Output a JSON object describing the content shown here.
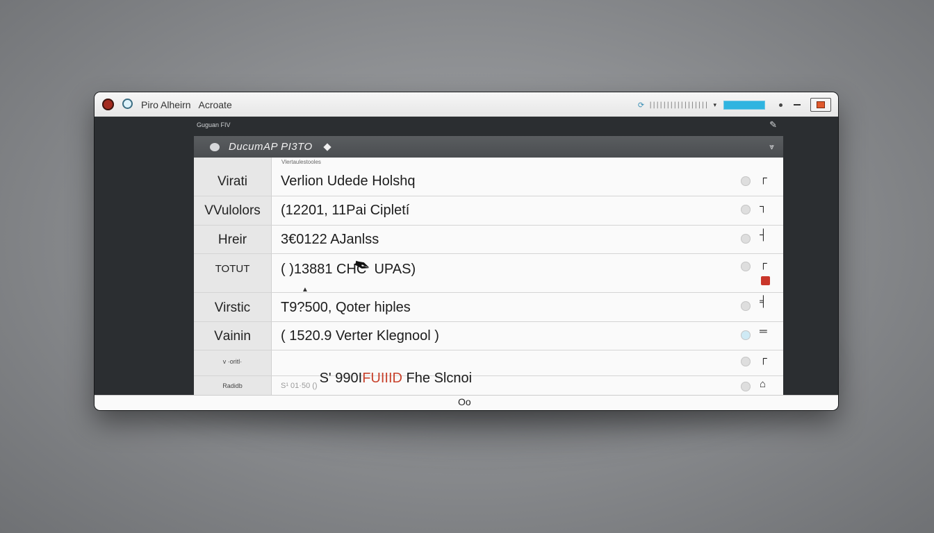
{
  "window": {
    "title": "Piro Alheirn   Acroate"
  },
  "titlebar": {
    "gauge_text": "|||||||||||||||||",
    "icons": [
      "refresh-icon",
      "progress-bar",
      "dot-icon",
      "minimize-icon",
      "maximize-icon"
    ]
  },
  "toolbar": {
    "breadcrumb": "Guguan FIV",
    "edit_icon": "pen-icon"
  },
  "panel": {
    "title": "DucumAP PI3TO",
    "subheader": "Vlertaulestooles",
    "collapse_icon": "chevron-down-icon"
  },
  "rows": [
    {
      "label": "Virati",
      "text": "Verlion Udede Holshq"
    },
    {
      "label": "VVulolors",
      "text": "(12201, 11Pai Cipletí"
    },
    {
      "label": "Hreir",
      "text": "3€0122 AJanlss"
    },
    {
      "label": "TOTUT",
      "text": "( )13881 CHC  UPAS)"
    },
    {
      "label": "Virstic",
      "text": "T9?500, Qoter hiples"
    },
    {
      "label": "Vаinin",
      "text": "( 1520.9 Verter Klegnool )"
    },
    {
      "label": "v ·oritl·",
      "text_a": "S' 990I",
      "text_red": "FUIIID",
      "text_b": " Fhe Slcnoi"
    },
    {
      "label": "Radidb",
      "text": "S¹ 01·50 ()"
    }
  ],
  "colors": {
    "accent": "#2fb4e0",
    "close": "#a32a1f",
    "alert": "#c9362a",
    "highlight_text": "#c8412b"
  },
  "statusbar": {
    "icon": "Oo"
  }
}
